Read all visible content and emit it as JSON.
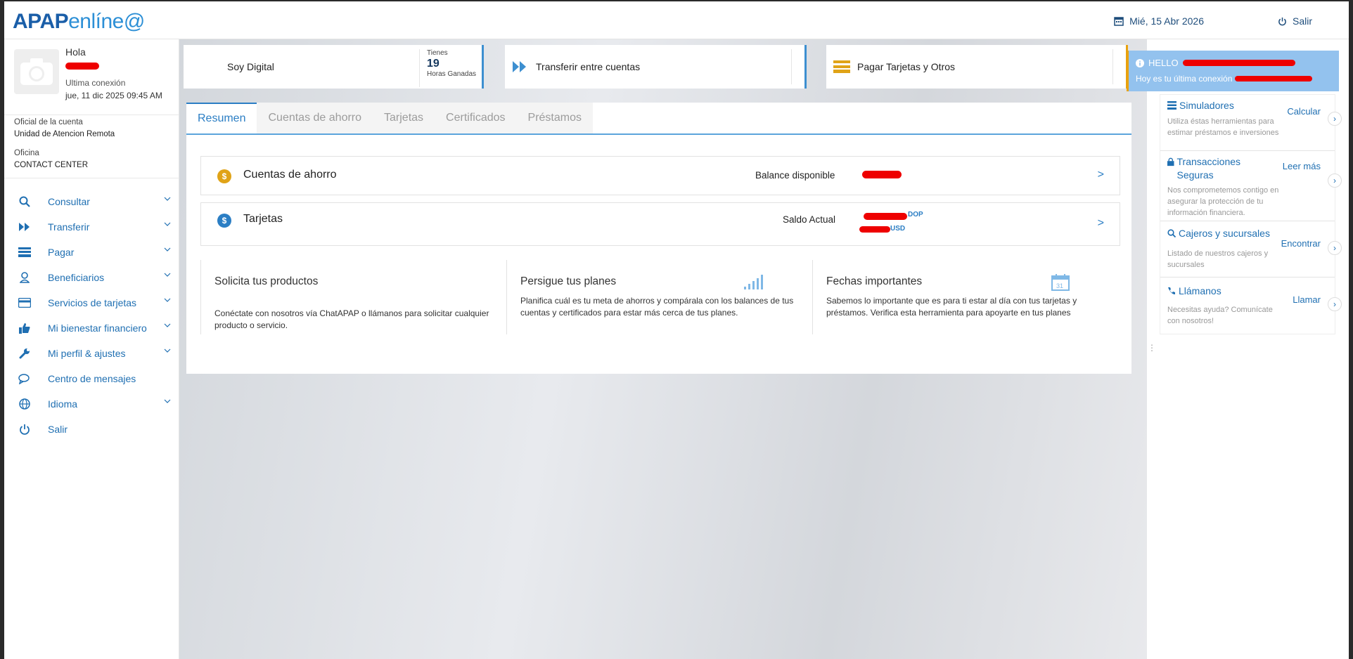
{
  "header": {
    "logo_bold": "APAP",
    "logo_light": "enlíne@",
    "date": "Mié, 15 Abr 2026",
    "logout": "Salir"
  },
  "profile": {
    "greeting": "Hola",
    "last_conn_label": "Ultima conexión",
    "last_conn_value": "jue, 11 dic 2025 09:45 AM",
    "officer_label": "Oficial de la cuenta",
    "officer_value": "Unidad de Atencion Remota",
    "office_label": "Oficina",
    "office_value": "CONTACT CENTER"
  },
  "menu": [
    {
      "label": "Consultar",
      "icon": "search-icon"
    },
    {
      "label": "Transferir",
      "icon": "fast-forward-icon"
    },
    {
      "label": "Pagar",
      "icon": "card-stack-icon"
    },
    {
      "label": "Beneficiarios",
      "icon": "user-icon"
    },
    {
      "label": "Servicios de tarjetas",
      "icon": "credit-card-icon"
    },
    {
      "label": "Mi bienestar financiero",
      "icon": "thumbs-up-icon"
    },
    {
      "label": "Mi perfil & ajustes",
      "icon": "wrench-icon"
    },
    {
      "label": "Centro de mensajes",
      "icon": "chat-icon"
    },
    {
      "label": "Idioma",
      "icon": "globe-icon"
    },
    {
      "label": "Salir",
      "icon": "power-icon"
    }
  ],
  "quick_actions": {
    "digital": {
      "label": "Soy Digital",
      "tienes": "Tienes",
      "hours": "19",
      "hours_label": "Horas Ganadas"
    },
    "transfer": {
      "label": "Transferir entre cuentas"
    },
    "pay": {
      "label": "Pagar Tarjetas y Otros"
    }
  },
  "tabs": [
    "Resumen",
    "Cuentas de ahorro",
    "Tarjetas",
    "Certificados",
    "Préstamos"
  ],
  "accounts": {
    "savings": {
      "name": "Cuentas de ahorro",
      "balance_label": "Balance disponible",
      "arrow": ">"
    },
    "cards": {
      "name": "Tarjetas",
      "balance_label": "Saldo Actual",
      "cur1": "DOP",
      "cur2": "USD",
      "arrow": ">"
    }
  },
  "promos": [
    {
      "title": "Solicita tus productos",
      "desc": "Conéctate con nosotros vía ChatAPAP o llámanos para solicitar cualquier producto o servicio."
    },
    {
      "title": "Persigue tus planes",
      "desc": "Planifica cuál es tu meta de ahorros y compárala con los balances de tus cuentas y certificados para estar más cerca de tus planes."
    },
    {
      "title": "Fechas importantes",
      "desc": "Sabemos lo importante que es para ti estar al día con tus tarjetas y préstamos. Verifica esta herramienta para apoyarte en tus planes"
    }
  ],
  "hello": {
    "title": "HELLO",
    "subtitle": "Hoy es tu última conexión"
  },
  "right_cards": [
    {
      "title": "Simuladores",
      "desc": "Utiliza éstas herramientas para estimar préstamos e inversiones",
      "action": "Calcular"
    },
    {
      "title": "Transacciones Seguras",
      "desc": "Nos comprometemos contigo en asegurar la protección de tu información financiera.",
      "action": "Leer más"
    },
    {
      "title": "Cajeros y sucursales",
      "desc": "Listado de nuestros cajeros y sucursales",
      "action": "Encontrar"
    },
    {
      "title": "Llámanos",
      "desc": "Necesitas ayuda? Comunícate con nosotros!",
      "action": "Llamar"
    }
  ],
  "colors": {
    "brand": "#1a5ea8",
    "accent": "#2b7ec4",
    "gold": "#e0a317",
    "hello_bg": "#93c2ee"
  }
}
